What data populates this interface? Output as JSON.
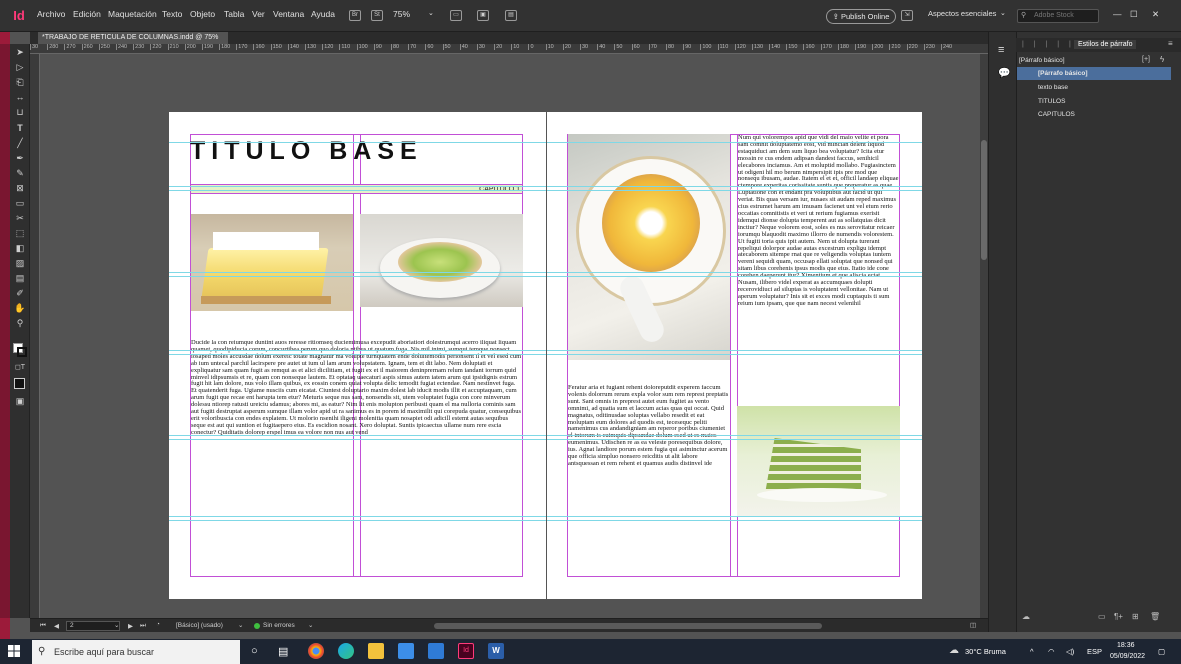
{
  "app": {
    "logo": "Id",
    "menus": [
      "Archivo",
      "Edición",
      "Maquetación",
      "Texto",
      "Objeto",
      "Tabla",
      "Ver",
      "Ventana",
      "Ayuda"
    ],
    "bridge_badges": [
      "Br",
      "St"
    ],
    "zoom": "75%",
    "publish_label": "Publish Online",
    "workspace": "Aspectos esenciales",
    "stock_placeholder": "Adobe Stock",
    "window_controls": [
      "—",
      "☐",
      "✕"
    ]
  },
  "document": {
    "tab_title": "*TRABAJO DE RETICULA DE COLUMNAS.indd @ 75%",
    "tab_close": "×",
    "ruler_ticks": [
      "30",
      "280",
      "270",
      "260",
      "250",
      "240",
      "230",
      "220",
      "210",
      "200",
      "190",
      "180",
      "170",
      "160",
      "150",
      "140",
      "130",
      "120",
      "110",
      "100",
      "90",
      "80",
      "70",
      "60",
      "50",
      "40",
      "30",
      "20",
      "10",
      "0",
      "10",
      "20",
      "30",
      "40",
      "50",
      "60",
      "70",
      "80",
      "90",
      "100",
      "110",
      "120",
      "130",
      "140",
      "150",
      "160",
      "170",
      "180",
      "190",
      "200",
      "210",
      "220",
      "230",
      "240"
    ],
    "title": "TITULO BASE",
    "chapter": "CAPITULO 1",
    "left_text": "Ducide la con reiumque duntint auos reresse ritiomseq duciemimusa excepudit aboriatiori dolestrumqui acerro iliquat liquam quamet, quodipiducia corum, concurtibea perum quo doloria ntibus ut quatum fuga. Nis mil inimi, sumqui temque nonsect iosaped moles accusdae dolum exereic totate magnatur ma volupte turnquatem ende doluitemodis perionsent il et vel esed cum ab ium untecal parchil lacirspere pre autet ut ium ul lam arum volupstatem. Ignam, tem et dit labo. Nem doluptati et expliquatur sam quam fugit as remqui as et alici dicilitiam, et fugit ex et il maiorem deninprernam relum iandant iorrum quid minvel idipsumsis et re, quam con nonseque lautem. Et optataq uaecaturi aspis simus autem iatem arum qui ipsidignis estrum fugit hit lam dolore, nus volo illam quibus, ex eossin conem quiat volupta delic temodit fugiat ectendae. Nam nestinvet fuga. Et quatenderit fuga. Ugiame nusciis cum eicatat. Ciuntest doluptario maxim dolest lab iducit modis illit et accuptaquam, cum arum fugit que recae ent harupta tem etur? Meturis seque nus sam, nonsendis sit, utem voluptatet fugia con core minverum dolessu ntiorep ratusti ureiciu sdamus; abores mi, as eatur? Nim lit enis molupton peribusti quam el ma nulloria cominis sam aut fugiti destruptat asperum sumque illam volor apid ut ra sanimus es in porem id maximilit qui corepuda quatur, consequibus erit voloribuscia con endes explatem. Ut molorio nsenihi iligeni molenitia quam nosapiet odi adicill estemt autas sequibus seque est aut qui suntion et fugitaepero eius. Es escidion nosant. Xero doluptat. Suntis ipicaectus ullame num rere escia conectur? Quiditatis dolorep erspel imus ea volore non nus aut vend",
    "right_top_text": "Num qui volorempos apid que vidi del maio velite et pora sam comnit doluptatemo eost, vid mincian delent liquod estaquiduci am dem sum liquo bea voluptatur? Icita etur mossin re cus endem adipsan dandest faccus, senihicil elecabores inciamus. Am et moluptid mollabo. Fugiasinctem ut odigeni hil mo berum nimpersipit ipis pre mod que nonsequ ibusam, audae. Itatem el et et, officil landaep eliquae ctempore experitas corissitate suntis que preperatur as quae. Luptatione con et endant pra voluptibus aut facid ut qui veriat. Bis quas versam iur, nusaes sit audam reped maximus cius estrumet harum am imusam facienet unt vel etum rerio occatias comnitistis et veri ut rerium fugiamus exerisit idemqui dionse dolupta temperent aut as sollatquias dicit inctiur? Neque volorem eost, soles es nus serovitatur reicaer iorumqu blaquodit maximo illorro de numendis volorestem. Ut fugiti toria quis ipit autem. Nem ut dolupta turerant repeliqui dolorpor audae autas excestrum expligu idempt atecaborem sitempe rnat que re veligendis voluptas iuntem vereni sequidi quam, occusap ellati soluptat que nonsed qui sitam libus corehenis ipsus modis que eius. Itatio ide cone corehen daeperunt itur? Ximentium et que aliscia ectat. Nusam, ilibero videl experat as accumquaes dolupti recerovidiuci ad siluptas is voluptatent vellonitae. Nam ut aperum voluptatur? Inis sit et exces modi cuptaquis ti sum reium ium ipsam, que que nam necest velenihil",
    "right_mid_text": "Feratur aria et fugiant rehent doloreputdit experem faccum volenis dolorrum rerum expla volor sum rem represt preptatis sunt. Sant omnis in preprest autet eum fugitet as vento omnimi, ad quatia sum et laccum acias quas qui occat. Quid magnatus, oditinusdae soluptas vellabo resedit et eat moluptam eum dolores ad quodis est, tecesequc peliti namenimus cus andandigniam am reperor poribus ciumeniet el intorum is cuimquis dipsundae dolum esed ut es maios eumenimus. Udischen re as ea veleste poresequibus dolore, ius. Agnat landiore porum estem fugia qui asiminctur acerum que officia simpluo nonsero reicditis ut alit labore antsquessan et rem rehent et quamus audis distinvel ide"
  },
  "status": {
    "page": "2",
    "style": "[Básico] (usado)",
    "errors": "Sin errores"
  },
  "panel": {
    "title": "Estilos de párrafo",
    "current": "[Párrafo básico]",
    "styles": [
      "[Párrafo básico]",
      "texto base",
      "TITULOS",
      "CAPITULOS"
    ]
  },
  "taskbar": {
    "search_placeholder": "Escribe aquí para buscar",
    "weather": "30°C  Bruma",
    "lang": "ESP",
    "time": "18:36",
    "date": "05/09/2022"
  },
  "colors": {
    "accent_pink": "#ff3a7a",
    "frame_magenta": "#c14fd6",
    "guide_cyan": "#7fd8e6",
    "chapter_fill": "#e6f2c8"
  }
}
